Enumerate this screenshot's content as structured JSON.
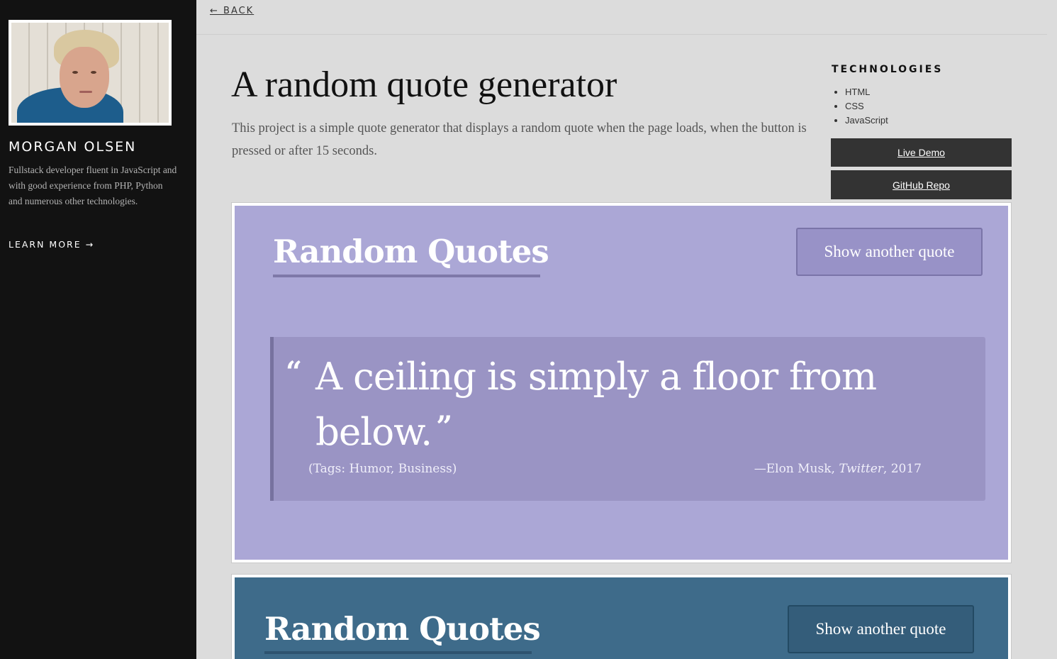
{
  "sidebar": {
    "name": "MORGAN OLSEN",
    "bio": "Fullstack developer fluent in JavaScript and with good experience from PHP, Python and numerous other technologies.",
    "learn_more": "LEARN MORE →"
  },
  "nav": {
    "back": "← BACK"
  },
  "project": {
    "title": "A random quote generator",
    "description": "This project is a simple quote generator that displays a random quote when the page loads, when the button is pressed or after 15 seconds.",
    "technologies_heading": "TECHNOLOGIES",
    "technologies": [
      "HTML",
      "CSS",
      "JavaScript"
    ],
    "live_demo": "Live Demo",
    "github_repo": "GitHub Repo"
  },
  "screenshots": [
    {
      "bg_color": "#aba7d6",
      "title": "Random Quotes",
      "button": "Show another quote",
      "quote": {
        "open_mark": "“",
        "text": "A ceiling is simply a floor from below.",
        "close_mark": "”",
        "tags": "(Tags: Humor, Business)",
        "author_prefix": "—Elon Musk, ",
        "source": "Twitter",
        "year_suffix": ", 2017"
      }
    },
    {
      "bg_color": "#3e6b8a",
      "title": "Random Quotes",
      "button": "Show another quote"
    }
  ]
}
